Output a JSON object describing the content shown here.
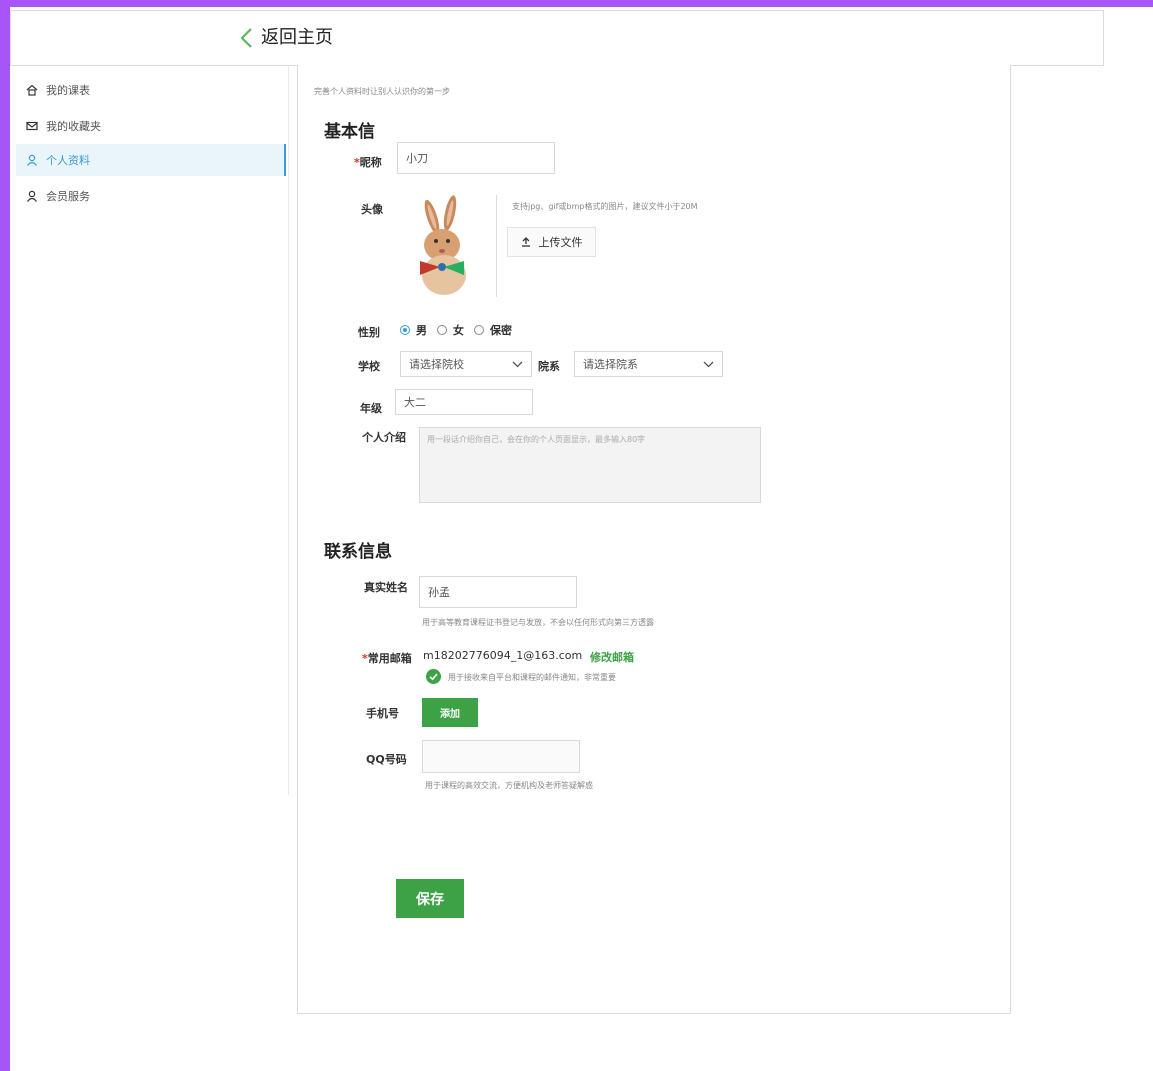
{
  "header": {
    "back_label": "返回主页"
  },
  "sidebar": {
    "items": [
      {
        "label": "我的课表",
        "icon": "home-icon"
      },
      {
        "label": "我的收藏夹",
        "icon": "mail-icon"
      },
      {
        "label": "个人资料",
        "icon": "user-icon",
        "active": true
      },
      {
        "label": "会员服务",
        "icon": "user-icon"
      }
    ]
  },
  "basic": {
    "intro_hint": "完善个人资料时让别人认识你的第一步",
    "title": "基本信",
    "nickname": {
      "label": "昵称",
      "value": "小刀"
    },
    "avatar": {
      "label": "头像",
      "hint": "支持jpg、gif或bmp格式的图片，建议文件小于20M",
      "upload_label": "上传文件"
    },
    "gender": {
      "label": "性别",
      "options": [
        "男",
        "女",
        "保密"
      ],
      "selected": "男"
    },
    "school": {
      "label": "学校",
      "value": "请选择院校"
    },
    "department": {
      "label": "院系",
      "value": "请选择院系"
    },
    "grade": {
      "label": "年级",
      "value": "大二"
    },
    "bio": {
      "label": "个人介绍",
      "placeholder": "用一段话介绍你自己，会在你的个人页面显示，最多输入80字"
    }
  },
  "contact": {
    "title": "联系信息",
    "real_name": {
      "label": "真实姓名",
      "value": "孙孟",
      "hint": "用于高等教育课程证书登记与发放，不会以任何形式向第三方透露"
    },
    "email": {
      "label": "常用邮箱",
      "value": "m18202776094_1@163.com",
      "edit_label": "修改邮箱",
      "hint": "用于接收来自平台和课程的邮件通知，非常重要"
    },
    "phone": {
      "label": "手机号",
      "add_label": "添加"
    },
    "qq": {
      "label": "QQ号码",
      "value": "",
      "hint": "用于课程的高效交流，方便机构及老师答疑解惑"
    }
  },
  "save_label": "保存",
  "colors": {
    "accent_green": "#3da245",
    "active_blue": "#3a9bd6",
    "frame_purple": "#a855f7"
  }
}
